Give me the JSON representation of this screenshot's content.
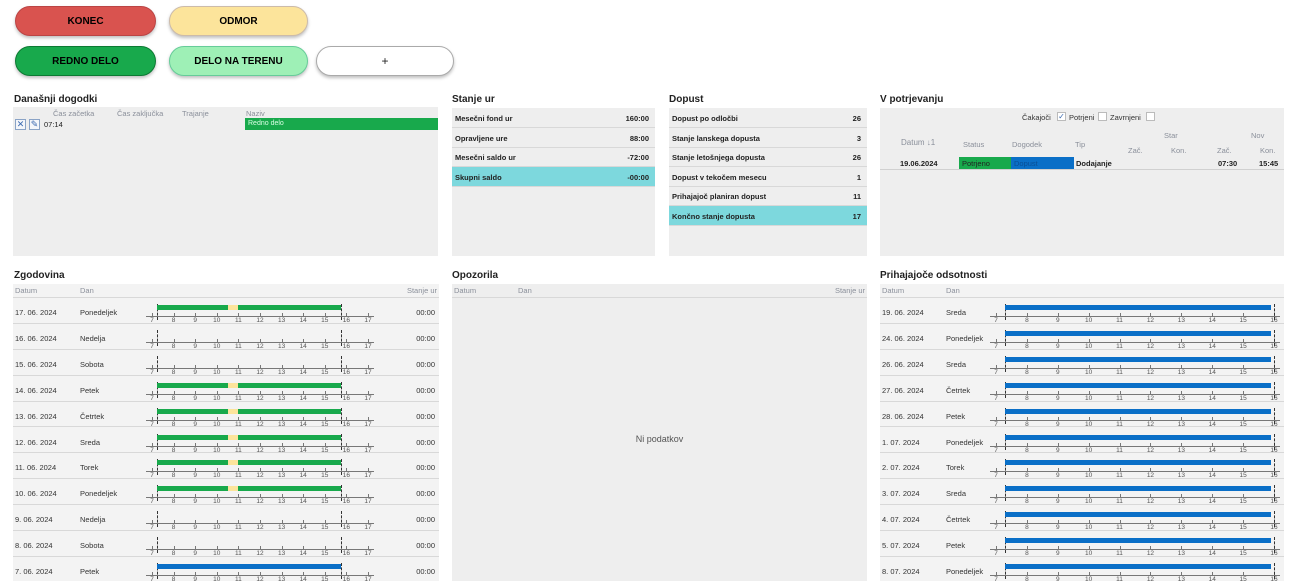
{
  "buttons": {
    "konec": "KONEC",
    "odmor": "ODMOR",
    "redno": "REDNO DELO",
    "teren": "DELO NA TERENU",
    "plus": "+"
  },
  "today": {
    "title": "Današnji dogodki",
    "headers": [
      "Čas začetka",
      "Čas zaključka",
      "Trajanje",
      "Naziv"
    ],
    "row": {
      "start": "07:14",
      "name": "Redno delo"
    }
  },
  "stanje": {
    "title": "Stanje ur",
    "rows": [
      {
        "label": "Mesečni fond ur",
        "value": "160:00"
      },
      {
        "label": "Opravljene ure",
        "value": "88:00"
      },
      {
        "label": "Mesečni saldo ur",
        "value": "-72:00"
      },
      {
        "label": "Skupni saldo",
        "value": "-00:00"
      }
    ]
  },
  "dopust": {
    "title": "Dopust",
    "rows": [
      {
        "label": "Dopust po odločbi",
        "value": "26"
      },
      {
        "label": "Stanje lanskega dopusta",
        "value": "3"
      },
      {
        "label": "Stanje letošnjega dopusta",
        "value": "26"
      },
      {
        "label": "Dopust v tekočem mesecu",
        "value": "1"
      },
      {
        "label": "Prihajajoč planiran dopust",
        "value": "11"
      },
      {
        "label": "Končno stanje dopusta",
        "value": "17"
      }
    ]
  },
  "potrjevanje": {
    "title": "V potrjevanju",
    "filters": {
      "cakajoci": "Čakajoči",
      "potrjeni": "Potrjeni",
      "zavrnjeni": "Zavrnjeni"
    },
    "headers": {
      "datum": "Datum ↓1",
      "status": "Status",
      "dogodek": "Dogodek",
      "tip": "Tip",
      "star": "Star",
      "nov": "Nov",
      "zac": "Zač.",
      "kon": "Kon."
    },
    "row": {
      "datum": "19.06.2024",
      "status": "Potrjeno",
      "dogodek": "Dopust",
      "tip": "Dodajanje",
      "nov_zac": "07:30",
      "nov_kon": "15:45"
    }
  },
  "zgodovina": {
    "title": "Zgodovina",
    "headers": {
      "datum": "Datum",
      "dan": "Dan",
      "stanje": "Stanje ur"
    },
    "hours": [
      "7",
      "8",
      "9",
      "10",
      "11",
      "12",
      "13",
      "14",
      "15",
      "16",
      "17"
    ],
    "rows": [
      {
        "date": "17. 06. 2024",
        "day": "Ponedeljek",
        "stanje": "00:00",
        "kind": "work"
      },
      {
        "date": "16. 06. 2024",
        "day": "Nedelja",
        "stanje": "00:00",
        "kind": "none"
      },
      {
        "date": "15. 06. 2024",
        "day": "Sobota",
        "stanje": "00:00",
        "kind": "none"
      },
      {
        "date": "14. 06. 2024",
        "day": "Petek",
        "stanje": "00:00",
        "kind": "work"
      },
      {
        "date": "13. 06. 2024",
        "day": "Četrtek",
        "stanje": "00:00",
        "kind": "work"
      },
      {
        "date": "12. 06. 2024",
        "day": "Sreda",
        "stanje": "00:00",
        "kind": "work"
      },
      {
        "date": "11. 06. 2024",
        "day": "Torek",
        "stanje": "00:00",
        "kind": "work"
      },
      {
        "date": "10. 06. 2024",
        "day": "Ponedeljek",
        "stanje": "00:00",
        "kind": "work"
      },
      {
        "date": "9. 06. 2024",
        "day": "Nedelja",
        "stanje": "00:00",
        "kind": "none"
      },
      {
        "date": "8. 06. 2024",
        "day": "Sobota",
        "stanje": "00:00",
        "kind": "none"
      },
      {
        "date": "7. 06. 2024",
        "day": "Petek",
        "stanje": "00:00",
        "kind": "leave"
      }
    ]
  },
  "opozorila": {
    "title": "Opozorila",
    "headers": {
      "datum": "Datum",
      "dan": "Dan",
      "stanje": "Stanje ur"
    },
    "empty": "Ni podatkov"
  },
  "odsotnosti": {
    "title": "Prihajajoče odsotnosti",
    "headers": {
      "datum": "Datum",
      "dan": "Dan"
    },
    "hours": [
      "7",
      "8",
      "9",
      "10",
      "11",
      "12",
      "13",
      "14",
      "15",
      "16"
    ],
    "rows": [
      {
        "date": "19. 06. 2024",
        "day": "Sreda"
      },
      {
        "date": "24. 06. 2024",
        "day": "Ponedeljek"
      },
      {
        "date": "26. 06. 2024",
        "day": "Sreda"
      },
      {
        "date": "27. 06. 2024",
        "day": "Četrtek"
      },
      {
        "date": "28. 06. 2024",
        "day": "Petek"
      },
      {
        "date": "1. 07. 2024",
        "day": "Ponedeljek"
      },
      {
        "date": "2. 07. 2024",
        "day": "Torek"
      },
      {
        "date": "3. 07. 2024",
        "day": "Sreda"
      },
      {
        "date": "4. 07. 2024",
        "day": "Četrtek"
      },
      {
        "date": "5. 07. 2024",
        "day": "Petek"
      },
      {
        "date": "8. 07. 2024",
        "day": "Ponedeljek"
      }
    ]
  },
  "colors": {
    "work": "#18a94c",
    "work_light": "#19c45a",
    "break": "#fce49b",
    "leave": "#0a6fc7",
    "highlight": "#7dd8dd"
  }
}
